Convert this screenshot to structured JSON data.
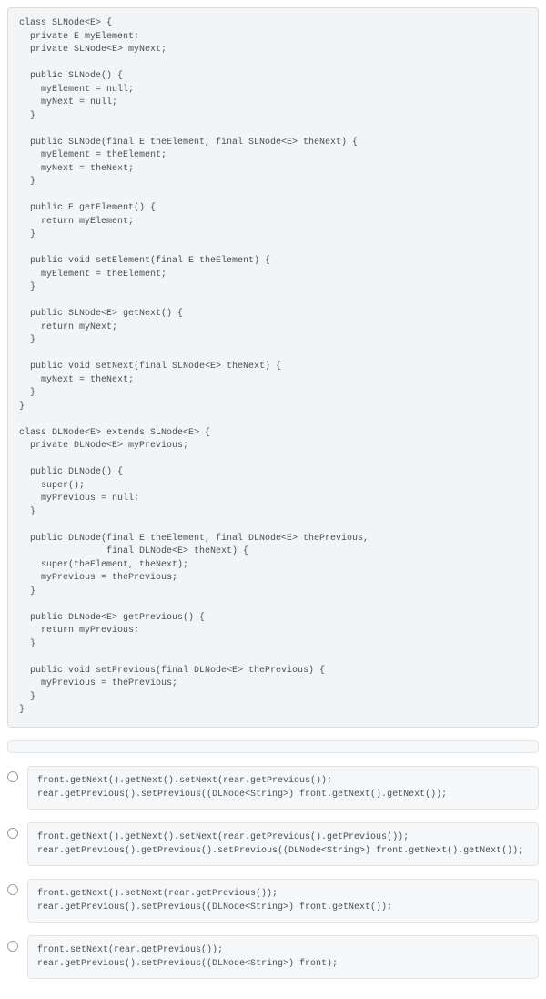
{
  "main_code": "class SLNode<E> {\n  private E myElement;\n  private SLNode<E> myNext;\n\n  public SLNode() {\n    myElement = null;\n    myNext = null;\n  }\n\n  public SLNode(final E theElement, final SLNode<E> theNext) {\n    myElement = theElement;\n    myNext = theNext;\n  }\n\n  public E getElement() {\n    return myElement;\n  }\n\n  public void setElement(final E theElement) {\n    myElement = theElement;\n  }\n\n  public SLNode<E> getNext() {\n    return myNext;\n  }\n\n  public void setNext(final SLNode<E> theNext) {\n    myNext = theNext;\n  }\n}\n\nclass DLNode<E> extends SLNode<E> {\n  private DLNode<E> myPrevious;\n\n  public DLNode() {\n    super();\n    myPrevious = null;\n  }\n\n  public DLNode(final E theElement, final DLNode<E> thePrevious,\n                final DLNode<E> theNext) {\n    super(theElement, theNext);\n    myPrevious = thePrevious;\n  }\n\n  public DLNode<E> getPrevious() {\n    return myPrevious;\n  }\n\n  public void setPrevious(final DLNode<E> thePrevious) {\n    myPrevious = thePrevious;\n  }\n}",
  "options": [
    {
      "code": "front.getNext().getNext().setNext(rear.getPrevious());\nrear.getPrevious().setPrevious((DLNode<String>) front.getNext().getNext());"
    },
    {
      "code": "front.getNext().getNext().setNext(rear.getPrevious().getPrevious());\nrear.getPrevious().getPrevious().setPrevious((DLNode<String>) front.getNext().getNext());"
    },
    {
      "code": "front.getNext().setNext(rear.getPrevious());\nrear.getPrevious().setPrevious((DLNode<String>) front.getNext());"
    },
    {
      "code": "front.setNext(rear.getPrevious());\nrear.getPrevious().setPrevious((DLNode<String>) front);"
    }
  ]
}
